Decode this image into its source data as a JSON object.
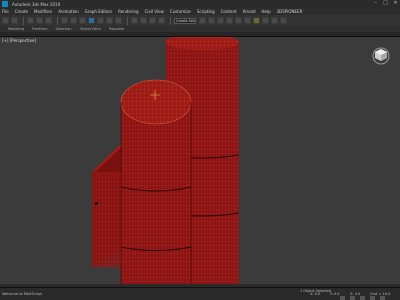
{
  "window": {
    "title": "Autodesk 3ds Max 2019",
    "min_glyph": "–",
    "max_glyph": "□",
    "close_glyph": "✕"
  },
  "menus": [
    "File",
    "Create",
    "Modifiers",
    "Animation",
    "Graph Editors",
    "Rendering",
    "Civil View",
    "Customize",
    "Scripting",
    "Content",
    "Arnold",
    "Help",
    "3DSPIONEER"
  ],
  "toolbar": {
    "dropdown_value": "Create Selection Se"
  },
  "ribbon": {
    "tabs": [
      "Modeling",
      "Freeform",
      "Selection",
      "Object Paint",
      "Populate"
    ]
  },
  "viewport": {
    "label": "[+] [Perspective]"
  },
  "status": {
    "left_text": "Welcome to MAXScript.",
    "mid_text": "1 Object Selected",
    "x_coord": "X: 0.0",
    "y_coord": "Y: 0.0",
    "z_coord": "Z: 0.0",
    "grid": "Grid = 10.0"
  },
  "colors": {
    "mesh_fill": "#8a1414",
    "mesh_wire": "#d23a2a",
    "viewport_bg": "#3b3b3b"
  }
}
